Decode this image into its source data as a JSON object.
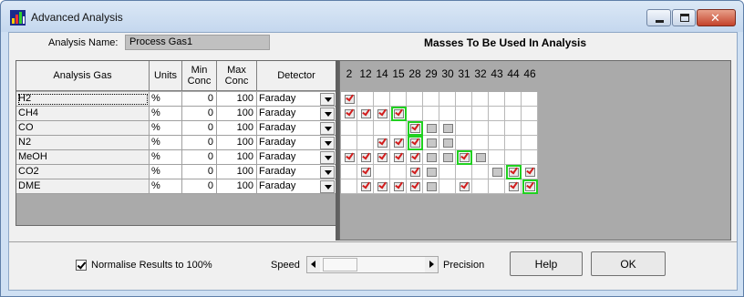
{
  "window": {
    "title": "Advanced Analysis"
  },
  "analysis": {
    "name_label": "Analysis Name:",
    "name_value": "Process Gas1"
  },
  "masses_title": "Masses To Be Used In Analysis",
  "table": {
    "headers": {
      "gas": "Analysis Gas",
      "units": "Units",
      "min": "Min Conc",
      "max": "Max Conc",
      "detector": "Detector"
    },
    "rows": [
      {
        "gas": "H2",
        "units": "%",
        "min": "0",
        "max": "100",
        "detector": "Faraday"
      },
      {
        "gas": "CH4",
        "units": "%",
        "min": "0",
        "max": "100",
        "detector": "Faraday"
      },
      {
        "gas": "CO",
        "units": "%",
        "min": "0",
        "max": "100",
        "detector": "Faraday"
      },
      {
        "gas": "N2",
        "units": "%",
        "min": "0",
        "max": "100",
        "detector": "Faraday"
      },
      {
        "gas": "MeOH",
        "units": "%",
        "min": "0",
        "max": "100",
        "detector": "Faraday"
      },
      {
        "gas": "CO2",
        "units": "%",
        "min": "0",
        "max": "100",
        "detector": "Faraday"
      },
      {
        "gas": "DME",
        "units": "%",
        "min": "0",
        "max": "100",
        "detector": "Faraday"
      }
    ]
  },
  "masses": [
    "2",
    "12",
    "14",
    "15",
    "28",
    "29",
    "30",
    "31",
    "32",
    "43",
    "44",
    "46"
  ],
  "mass_grid": [
    {
      "checked": [
        "2"
      ],
      "grayed": [],
      "highlight": []
    },
    {
      "checked": [
        "2",
        "12",
        "14",
        "15"
      ],
      "grayed": [],
      "highlight": [
        "15"
      ]
    },
    {
      "checked": [
        "28"
      ],
      "grayed": [
        "29",
        "30"
      ],
      "highlight": [
        "28"
      ]
    },
    {
      "checked": [
        "14",
        "15",
        "28"
      ],
      "grayed": [
        "29",
        "30"
      ],
      "highlight": [
        "28"
      ]
    },
    {
      "checked": [
        "2",
        "12",
        "14",
        "15",
        "28",
        "31"
      ],
      "grayed": [
        "29",
        "30",
        "32"
      ],
      "highlight": [
        "31"
      ]
    },
    {
      "checked": [
        "12",
        "28",
        "44",
        "46"
      ],
      "grayed": [
        "29",
        "43"
      ],
      "highlight": [
        "44"
      ]
    },
    {
      "checked": [
        "12",
        "14",
        "15",
        "28",
        "31",
        "44",
        "46"
      ],
      "grayed": [
        "29"
      ],
      "highlight": [
        "46"
      ]
    }
  ],
  "footer": {
    "normalise_label": "Normalise Results to 100%",
    "normalise_checked": true,
    "speed_label": "Speed",
    "precision_label": "Precision",
    "help_label": "Help",
    "ok_label": "OK"
  }
}
